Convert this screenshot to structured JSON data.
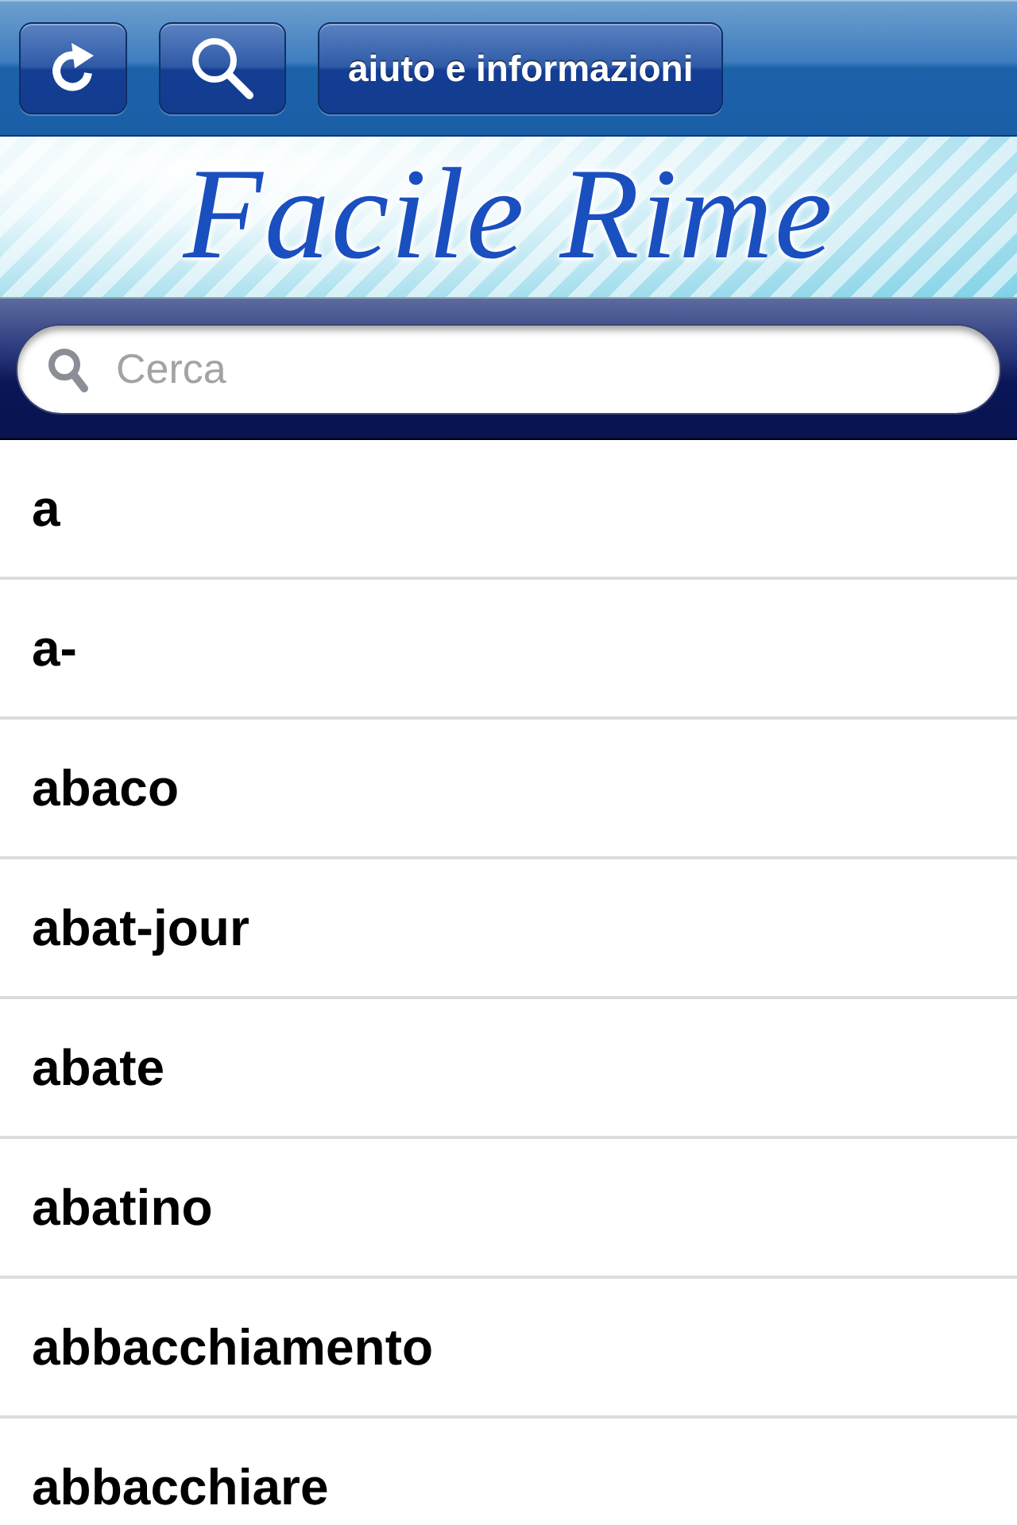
{
  "toolbar": {
    "buttons": [
      {
        "kind": "refresh"
      },
      {
        "kind": "search"
      },
      {
        "kind": "text",
        "label": "aiuto e informazioni"
      }
    ]
  },
  "banner": {
    "title": "Facile Rime"
  },
  "search": {
    "placeholder": "Cerca"
  },
  "words": [
    "a",
    "a-",
    "abaco",
    "abat-jour",
    "abate",
    "abatino",
    "abbacchiamento",
    "abbacchiare"
  ]
}
